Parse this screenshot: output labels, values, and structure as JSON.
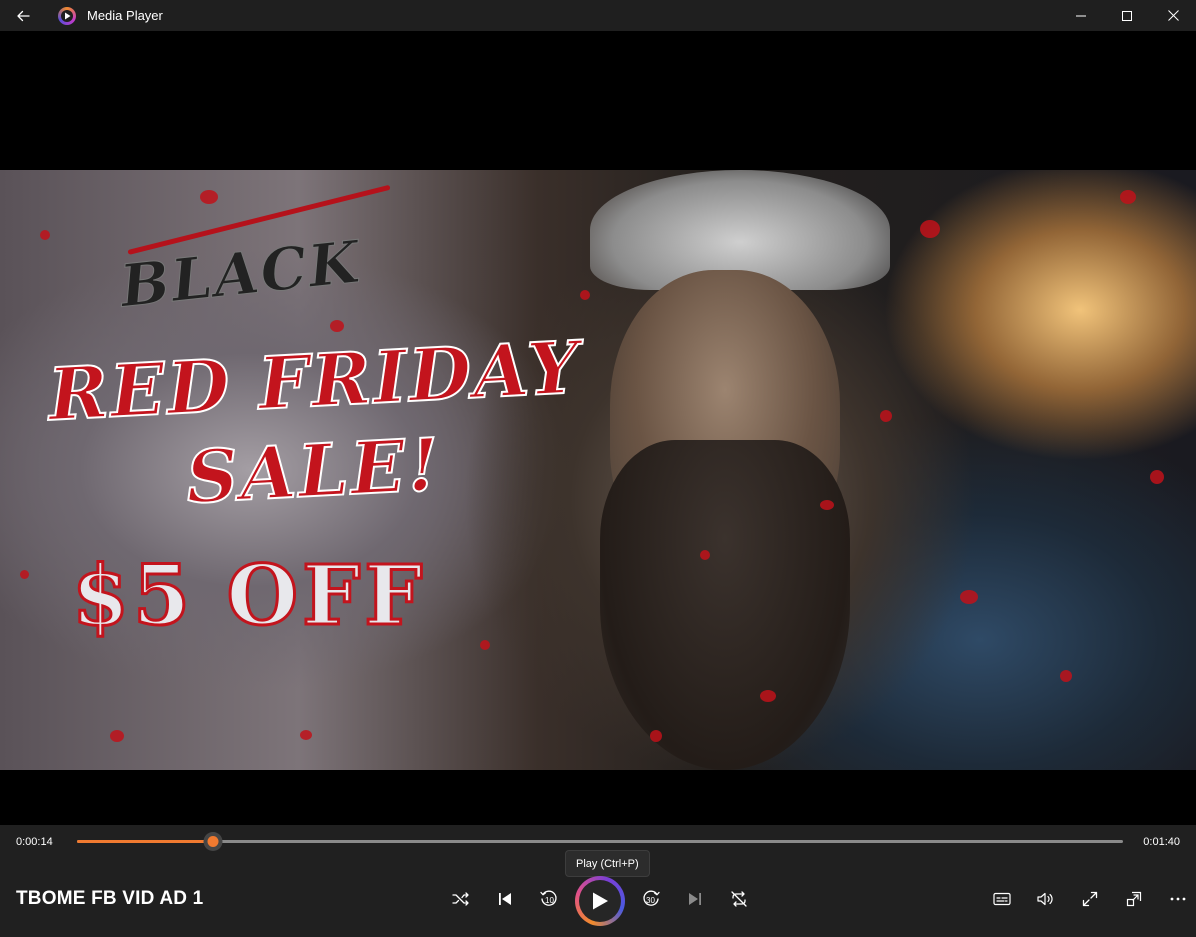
{
  "app": {
    "title": "Media Player",
    "back_icon": "back-arrow-icon"
  },
  "window_controls": {
    "minimize_icon": "minimize-icon",
    "maximize_icon": "maximize-icon",
    "close_icon": "close-icon"
  },
  "video": {
    "frame_text": {
      "black": "BLACK",
      "red_friday": "RED FRIDAY",
      "sale": "SALE!",
      "discount": "$5 OFF"
    }
  },
  "playback": {
    "current_time": "0:00:14",
    "total_time": "0:01:40",
    "progress": 0.13,
    "tooltip": "Play (Ctrl+P)"
  },
  "media": {
    "title": "TBOME FB VID AD 1"
  },
  "controls": {
    "shuffle_icon": "shuffle-icon",
    "previous_icon": "previous-track-icon",
    "skip_back_icon": "skip-back-10-icon",
    "skip_back_label": "10",
    "play_icon": "play-icon",
    "skip_forward_icon": "skip-forward-30-icon",
    "skip_forward_label": "30",
    "next_icon": "next-track-icon",
    "repeat_icon": "repeat-off-icon",
    "captions_icon": "captions-icon",
    "volume_icon": "volume-icon",
    "fullscreen_icon": "fullscreen-icon",
    "miniplayer_icon": "miniplayer-icon",
    "more_icon": "more-options-icon"
  },
  "colors": {
    "accent": "#f07a30",
    "panel_bg": "#202020",
    "titlebar_bg": "#1f1f1f"
  }
}
